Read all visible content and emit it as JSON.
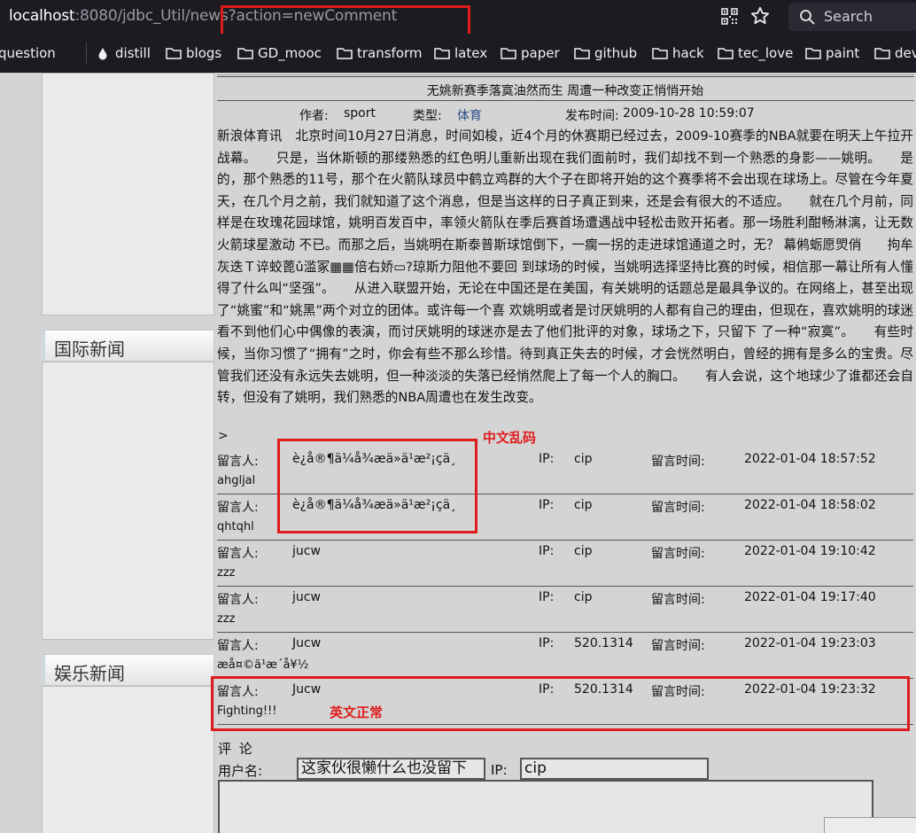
{
  "browser": {
    "url_host": "localhost",
    "url_path": ":8080/jdbc_Util/news?action=newComment",
    "search_label": "Search",
    "bookmarks": [
      {
        "label": "question",
        "icon": "folder-icon"
      },
      {
        "label": "distill",
        "icon": "drop-icon"
      },
      {
        "label": "blogs",
        "icon": "folder-icon"
      },
      {
        "label": "GD_mooc",
        "icon": "folder-icon"
      },
      {
        "label": "transform",
        "icon": "folder-icon"
      },
      {
        "label": "latex",
        "icon": "folder-icon"
      },
      {
        "label": "paper",
        "icon": "folder-icon"
      },
      {
        "label": "github",
        "icon": "folder-icon"
      },
      {
        "label": "hack",
        "icon": "folder-icon"
      },
      {
        "label": "tec_love",
        "icon": "folder-icon"
      },
      {
        "label": "paint",
        "icon": "folder-icon"
      },
      {
        "label": "dev",
        "icon": "folder-icon"
      }
    ]
  },
  "sidebar": {
    "sections": [
      {
        "title": "国际新闻"
      },
      {
        "title": "娱乐新闻"
      }
    ]
  },
  "news": {
    "title": "无姚新赛季落寞油然而生 周遭一种改变正悄悄开始",
    "author_label": "作者:",
    "author": "sport",
    "type_label": "类型:",
    "type": "体育",
    "time_label": "发布时间:",
    "time": "2009-10-28 10:59:07",
    "content": "新浪体育讯　北京时间10月27日消息，时间如梭，近4个月的休赛期已经过去，2009-10赛季的NBA就要在明天上午拉开战幕。　　只是，当休斯顿的那缕熟悉的红色明儿重新出现在我们面前时，我们却找不到一个熟悉的身影——姚明。　　是的，那个熟悉的11号，那个在火箭队球员中鹤立鸡群的大个子在即将开始的这个赛季将不会出现在球场上。尽管在今年夏天，在几个月之前，我们就知道了这个消息，但是当这样的日子真正到来，还是会有很大的不适应。　　就在几个月前，同样是在玫瑰花园球馆，姚明百发百中，率领火箭队在季后赛首场遭遇战中轻松击败开拓者。那一场胜利酣畅淋漓，让无数火箭球星激动 不已。而那之后，当姚明在斯泰普斯球馆倒下，一瘸一拐的走进球馆通道之时，无？ 幕鸺蛎愿焽俏　　拘牟灰迭Ｔ谇蛟蓖ǔ滥冢▦▦倍右娇▭?琼斯力阻他不要回 到球场的时候，当姚明选择坚持比赛的时候，相信那一幕让所有人懂得了什么叫“坚强”。　　从进入联盟开始，无论在中国还是在美国，有关姚明的话题总是最具争议的。在网络上，甚至出现了“姚蜜”和“姚黑”两个对立的团体。或许每一个喜 欢姚明或者是讨厌姚明的人都有自己的理由，但现在，喜欢姚明的球迷看不到他们心中偶像的表演，而讨厌姚明的球迷亦是去了他们批评的对象，球场之下，只留下 了一种“寂寞”。　　有些时候，当你习惯了“拥有”之时，你会有些不那么珍惜。待到真正失去的时候，才会恍然明白，曾经的拥有是多么的宝贵。尽管我们还没有永远失去姚明，但一种淡淡的失落已经悄然爬上了每一个人的胸口。　　有人会说，这个地球少了谁都还会自转，但没有了姚明，我们熟悉的NBA周遭也在发生改变。"
  },
  "comments_marker": ">",
  "comment_labels": {
    "author": "留言人:",
    "ip": "IP:",
    "time": "留言时间:"
  },
  "comments": [
    {
      "author": "è¿å®¶ä¼å¾æä»ä¹æ²¡çä¸",
      "ip": "cip",
      "time": "2022-01-04 18:57:52",
      "text": "ahgljal"
    },
    {
      "author": "è¿å®¶ä¼å¾æä»ä¹æ²¡çä¸",
      "ip": "cip",
      "time": "2022-01-04 18:58:02",
      "text": "qhtqhl"
    },
    {
      "author": "jucw",
      "ip": "cip",
      "time": "2022-01-04 19:10:42",
      "text": "zzz"
    },
    {
      "author": "jucw",
      "ip": "cip",
      "time": "2022-01-04 19:17:40",
      "text": "zzz"
    },
    {
      "author": "Jucw",
      "ip": "520.1314",
      "time": "2022-01-04 19:23:03",
      "text": "æå¤©ä¹æ´å¥½"
    },
    {
      "author": "Jucw",
      "ip": "520.1314",
      "time": "2022-01-04 19:23:32",
      "text": "Fighting!!!"
    }
  ],
  "form": {
    "title": "评 论",
    "username_label": "用户名:",
    "username_value": "这家伙很懒什么也没留下",
    "ip_label": "IP:",
    "ip_value": "cip"
  },
  "annotations": {
    "garbled_label": "中文乱码",
    "english_label": "英文正常",
    "color": "#e01b1b"
  }
}
